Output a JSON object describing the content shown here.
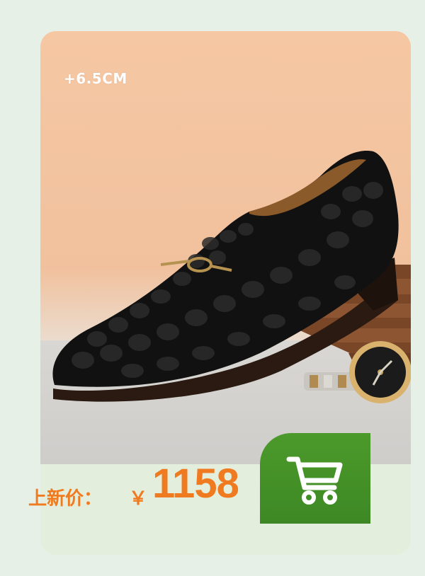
{
  "product": {
    "height_badge": "+6.5CM",
    "image_alt": "Black crocodile-embossed loafer with gold horsebit, wooden stand and wristwatch"
  },
  "price": {
    "label": "上新价：",
    "currency": "￥",
    "value": "1158"
  },
  "cart": {
    "icon": "shopping-cart-icon"
  },
  "colors": {
    "page_bg": "#e6f0e6",
    "accent_orange": "#f07a1f",
    "cart_green": "#4c9a2b"
  }
}
